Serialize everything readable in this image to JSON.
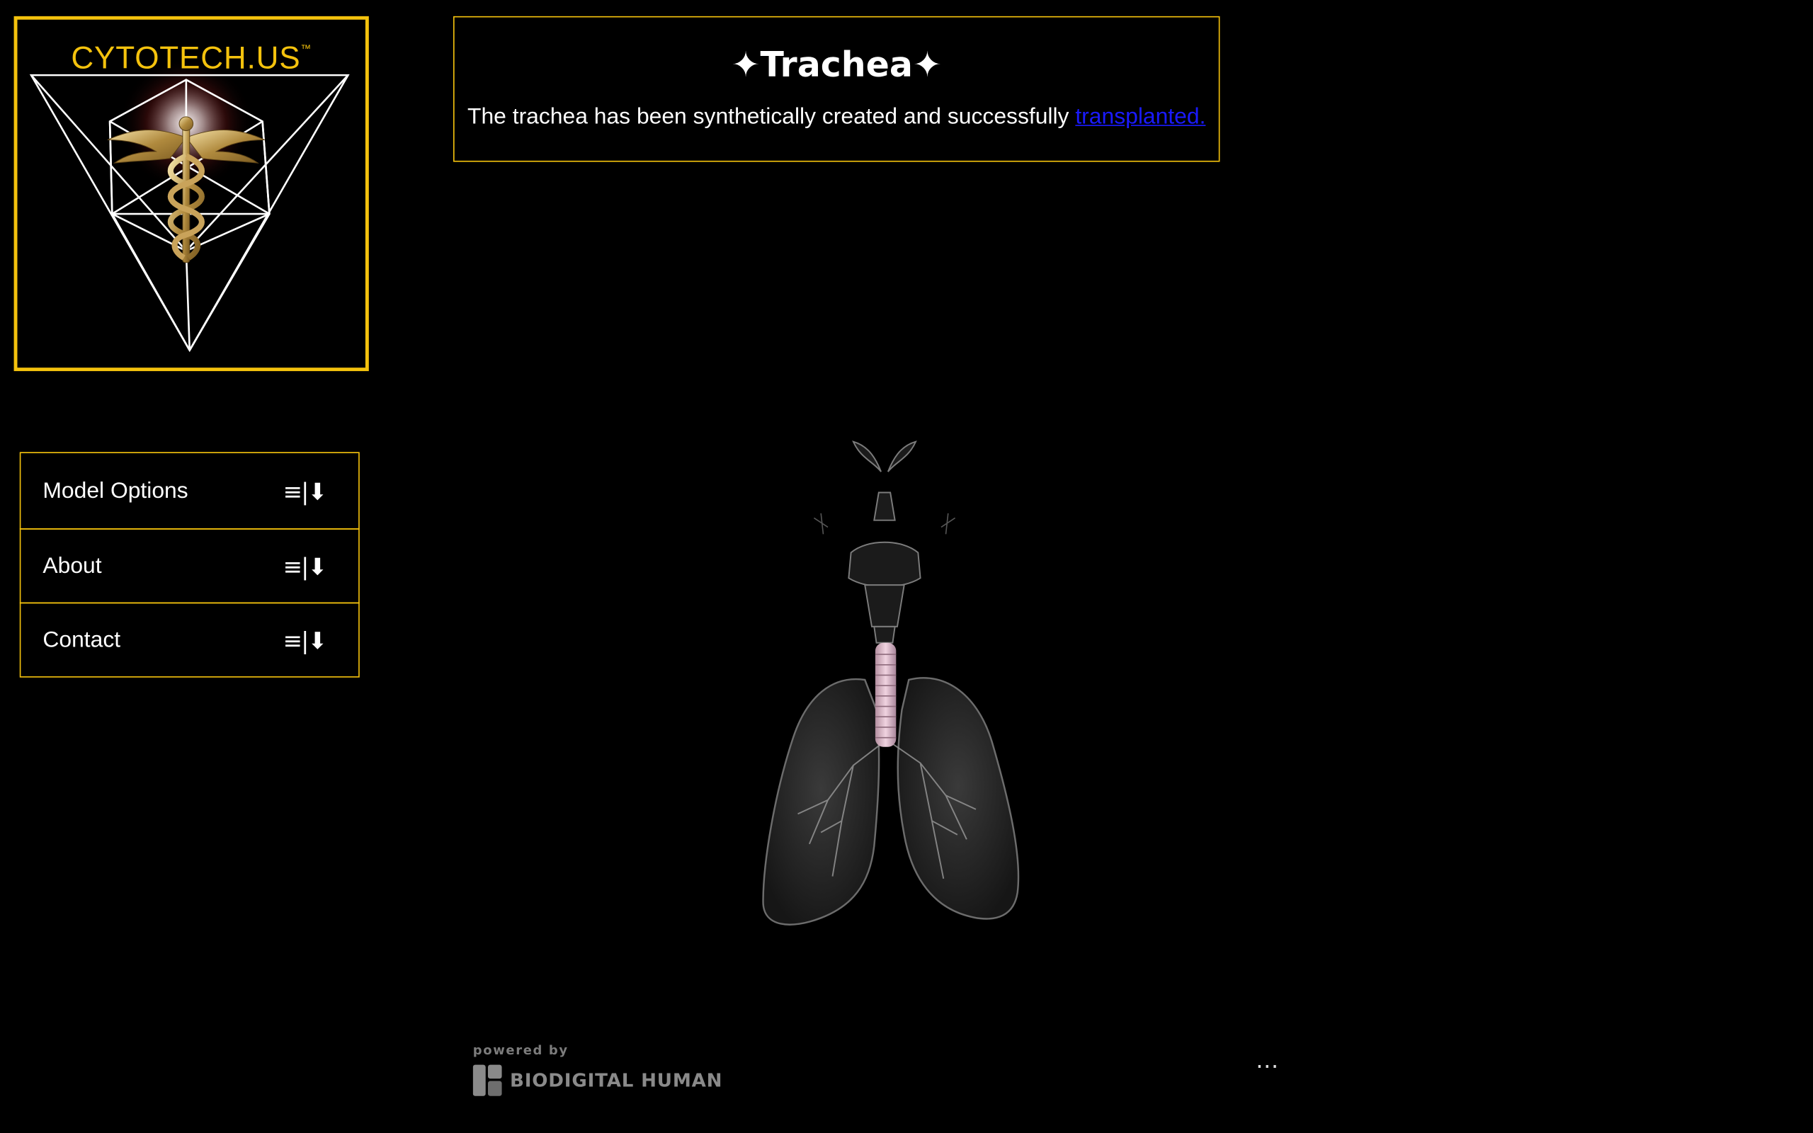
{
  "logo": {
    "brand": "CYTOTECH",
    "suffix": ".US",
    "trademark": "™",
    "icon": "caduceus-in-tetrahedron-logo"
  },
  "menu": {
    "items": [
      {
        "label": "Model Options",
        "icon": "≡|⬇"
      },
      {
        "label": "About",
        "icon": "≡|⬇"
      },
      {
        "label": "Contact",
        "icon": "≡|⬇"
      }
    ]
  },
  "info": {
    "title": "✦Trachea✦",
    "text": "The trachea has been synthetically created and successfully",
    "link_text": "transplanted."
  },
  "viewer": {
    "model_icon": "trachea-lungs-3d-model"
  },
  "footer": {
    "powered_by": "powered by",
    "brand": "BIODIGITAL HUMAN",
    "more_label": "⋯"
  },
  "colors": {
    "accent": "#f4c20d",
    "background": "#000000",
    "link": "#1a1aff"
  }
}
